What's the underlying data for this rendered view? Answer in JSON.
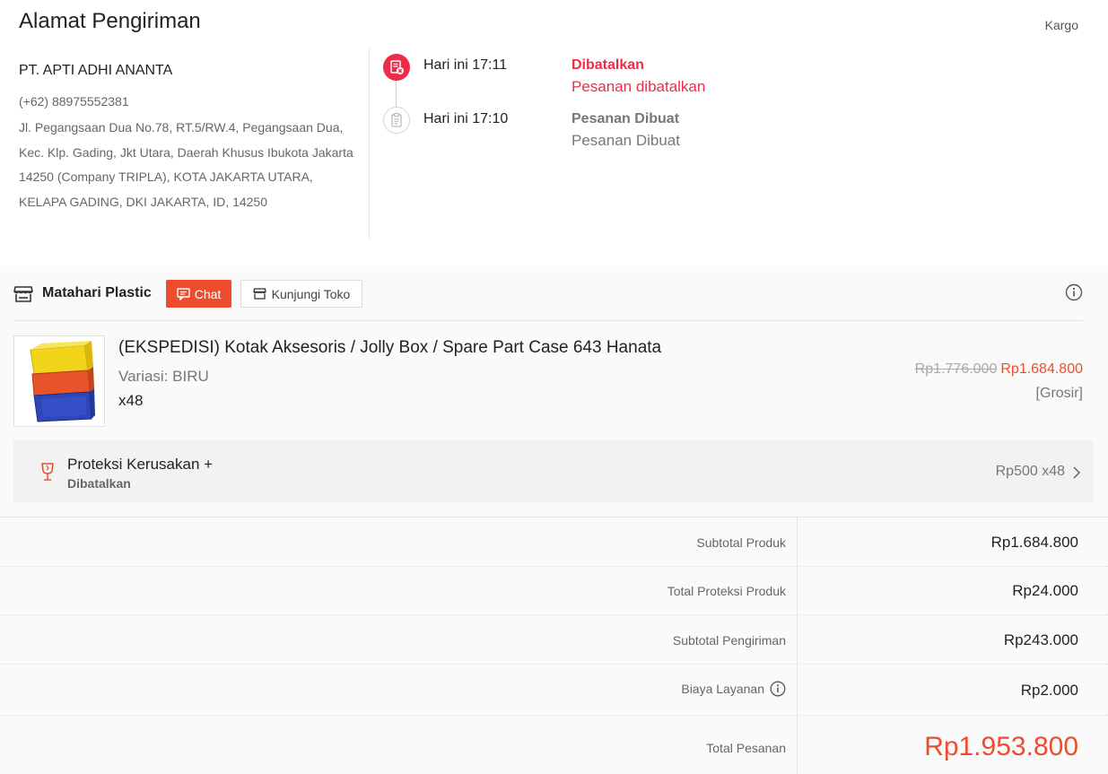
{
  "address": {
    "title": "Alamat Pengiriman",
    "courier": "Kargo",
    "name": "PT. APTI ADHI ANANTA",
    "phone": "(+62) 88975552381",
    "full_address": "Jl. Pegangsaan Dua No.78, RT.5/RW.4, Pegangsaan Dua, Kec. Klp. Gading, Jkt Utara, Daerah Khusus Ibukota Jakarta 14250 (Company TRIPLA), KOTA JAKARTA UTARA, KELAPA GADING, DKI JAKARTA, ID, 14250"
  },
  "timeline": [
    {
      "time": "Hari ini 17:11",
      "status": "Dibatalkan",
      "description": "Pesanan dibatalkan",
      "icon": "cancelled-doc-icon"
    },
    {
      "time": "Hari ini 17:10",
      "status": "Pesanan Dibuat",
      "description": "Pesanan Dibuat",
      "icon": "document-icon"
    }
  ],
  "shop": {
    "name": "Matahari Plastic",
    "chat_label": "Chat",
    "visit_label": "Kunjungi Toko"
  },
  "product": {
    "name": "(EKSPEDISI) Kotak Aksesoris / Jolly Box / Spare Part Case 643 Hanata",
    "variation": "Variasi: BIRU",
    "quantity": "x48",
    "original_price": "Rp1.776.000",
    "price": "Rp1.684.800",
    "price_tag": "[Grosir]"
  },
  "protection": {
    "title": "Proteksi Kerusakan +",
    "status": "Dibatalkan",
    "price": "Rp500 x48"
  },
  "summary": [
    {
      "label": "Subtotal Produk",
      "value": "Rp1.684.800"
    },
    {
      "label": "Total Proteksi Produk",
      "value": "Rp24.000"
    },
    {
      "label": "Subtotal Pengiriman",
      "value": "Rp243.000"
    },
    {
      "label": "Biaya Layanan",
      "value": "Rp2.000"
    },
    {
      "label": "Total Pesanan",
      "value": "Rp1.953.800"
    }
  ],
  "colors": {
    "accent": "#ee4d2d",
    "cancelled": "#ee2c4a"
  }
}
